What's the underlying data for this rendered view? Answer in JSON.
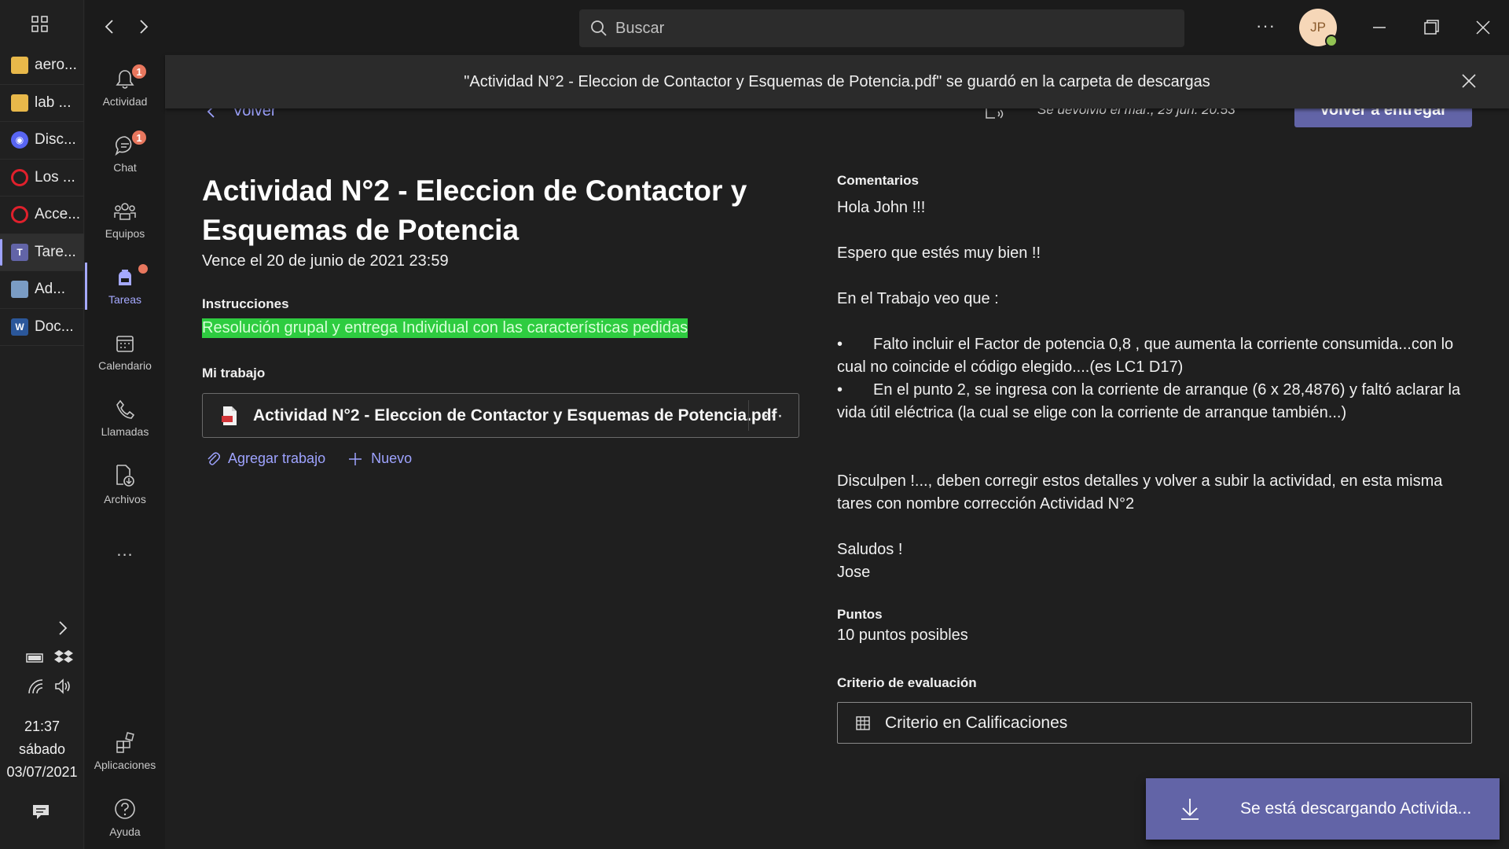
{
  "taskbar": {
    "items": [
      {
        "label": "aero...",
        "icon": "folder-icon",
        "color": "#e8b84a"
      },
      {
        "label": "lab ...",
        "icon": "folder-icon",
        "color": "#e8b84a"
      },
      {
        "label": "Disc...",
        "icon": "discord-icon",
        "color": "#5865f2"
      },
      {
        "label": "Los ...",
        "icon": "opera-icon",
        "color": "#e0202c"
      },
      {
        "label": "Acce...",
        "icon": "opera-icon",
        "color": "#e0202c"
      },
      {
        "label": "Tare...",
        "icon": "teams-icon",
        "color": "#6264a7"
      },
      {
        "label": "Ad...",
        "icon": "app-icon",
        "color": "#7a9cc4"
      },
      {
        "label": "Doc...",
        "icon": "word-icon",
        "color": "#2b579a"
      }
    ],
    "clock": {
      "time": "21:37",
      "day": "sábado",
      "date": "03/07/2021"
    }
  },
  "rail": {
    "items": [
      {
        "label": "Actividad",
        "icon": "bell-icon",
        "badge": "1"
      },
      {
        "label": "Chat",
        "icon": "chat-icon",
        "badge": "1"
      },
      {
        "label": "Equipos",
        "icon": "teams-group-icon"
      },
      {
        "label": "Tareas",
        "icon": "backpack-icon",
        "active": true
      },
      {
        "label": "Calendario",
        "icon": "calendar-icon"
      },
      {
        "label": "Llamadas",
        "icon": "phone-icon"
      },
      {
        "label": "Archivos",
        "icon": "files-icon"
      }
    ],
    "more": "...",
    "apps_label": "Aplicaciones",
    "help_label": "Ayuda"
  },
  "titlebar": {
    "search_placeholder": "Buscar",
    "more": "···",
    "avatar_initials": "JP"
  },
  "banner": {
    "text": "\"Actividad N°2 - Eleccion de Contactor y Esquemas de Potencia.pdf\" se guardó en la carpeta de descargas"
  },
  "header": {
    "back_label": "Volver",
    "returned_text": "Se devolvió el mar., 29 jun. 20:53",
    "resubmit_label": "Volver a entregar"
  },
  "assignment": {
    "title": "Actividad N°2 - Eleccion de Contactor y Esquemas de Potencia",
    "due": "Vence el 20 de junio de 2021 23:59",
    "instructions_label": "Instrucciones",
    "instructions": "Resolución grupal y entrega Individual con las características pedidas",
    "my_work_label": "Mi trabajo",
    "file_name": "Actividad N°2 - Eleccion de Contactor y Esquemas de Potencia.pdf",
    "file_more": "···",
    "add_work_label": "Agregar trabajo",
    "new_label": "Nuevo"
  },
  "comments": {
    "label": "Comentarios",
    "greeting": "Hola John !!!",
    "line2": "Espero que estés muy bien !!",
    "line3": "En el Trabajo veo que :",
    "bullet1": "Falto incluir el Factor de potencia 0,8 , que aumenta la corriente consumida...con lo cual no coincide el código elegido....(es LC1 D17)",
    "bullet2": "En el punto 2, se ingresa con la corriente de arranque (6 x 28,4876) y faltó aclarar la vida útil eléctrica (la cual se elige con la corriente de arranque también...)",
    "line4": "Disculpen !..., deben corregir estos detalles y volver a subir la actividad, en esta misma tares con nombre corrección Actividad N°2",
    "signoff": "Saludos  !",
    "signature": "Jose"
  },
  "points": {
    "label": "Puntos",
    "value": "10 puntos posibles"
  },
  "criteria": {
    "label": "Criterio de evaluación",
    "button": "Criterio en Calificaciones"
  },
  "toast": {
    "text": "Se está descargando Activida..."
  },
  "colors": {
    "accent": "#6264a7",
    "highlight": "#2ecc40",
    "link": "#9ea3ff",
    "badge": "#e8775e"
  }
}
